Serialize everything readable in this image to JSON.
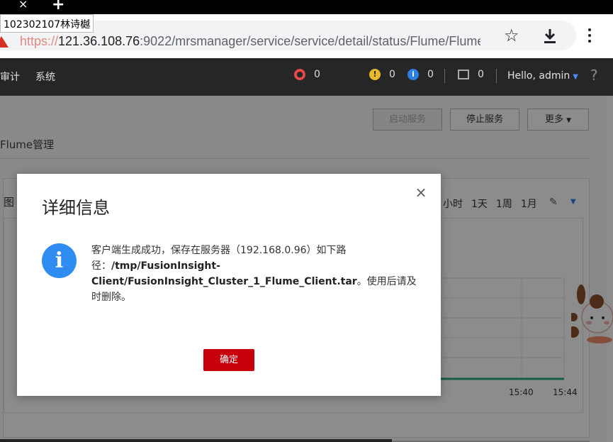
{
  "browser": {
    "url_scheme": "https://",
    "url_host": "121.36.108.76",
    "url_rest": ":9022/mrsmanager/service/service/detail/status/Flume/Flume",
    "overlay_label": "102302107林诗樾"
  },
  "navbar": {
    "items": [
      "审计",
      "系统"
    ],
    "alarms": {
      "critical": "0",
      "major": "0",
      "minor": "0",
      "tasks": "0"
    },
    "user": "Hello, admin",
    "help": "?"
  },
  "page": {
    "buttons": {
      "start": "启动服务",
      "stop": "停止服务",
      "more": "更多"
    },
    "subtitle": "Flume管理",
    "panel_title": "图",
    "time_ranges": [
      "小时",
      "1天",
      "1周",
      "1月"
    ],
    "x_ticks": [
      "15:40",
      "15:44"
    ]
  },
  "modal": {
    "title": "详细信息",
    "close": "×",
    "msg_prefix": "客户端生成成功，保存在服务器（192.168.0.96）如下路径：",
    "msg_path": "/tmp/FusionInsight-Client/FusionInsight_Cluster_1_Flume_Client.tar",
    "msg_suffix": "。使用后请及时删除。",
    "ok": "确定"
  },
  "colors": {
    "navbar": "#262626",
    "accent": "#c7000b",
    "info": "#2f8cf0",
    "chart_line": "#2ba882"
  }
}
